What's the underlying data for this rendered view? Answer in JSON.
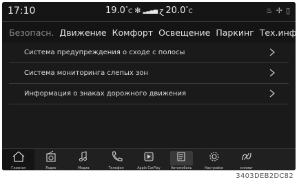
{
  "status": {
    "time": "17:10",
    "left_temp": "19.0",
    "right_temp": "20.0",
    "deg_unit": "C",
    "right_icons": [
      "seat-heat-icon",
      "seat-cool-icon",
      "phone-battery-icon"
    ]
  },
  "tabs": [
    {
      "label": "Безопасн."
    },
    {
      "label": "Движение"
    },
    {
      "label": "Комфорт"
    },
    {
      "label": "Освещение"
    },
    {
      "label": "Паркинг"
    },
    {
      "label": "Тех.инфо"
    }
  ],
  "settings": [
    {
      "label": "Система предупреждения о сходе с полосы"
    },
    {
      "label": "Система мониторинга слепых зон"
    },
    {
      "label": "Информация о знаках дорожного движения"
    }
  ],
  "dock": [
    {
      "label": "Главная",
      "icon": "home-icon"
    },
    {
      "label": "Радио",
      "icon": "radio-icon"
    },
    {
      "label": "Медиа",
      "icon": "music-note-icon"
    },
    {
      "label": "Телефон",
      "icon": "phone-icon"
    },
    {
      "label": "Apple CarPlay",
      "icon": "carplay-icon"
    },
    {
      "label": "Автомобиль",
      "icon": "vehicle-icon"
    },
    {
      "label": "Настройки",
      "icon": "gear-icon"
    },
    {
      "label": "климат",
      "icon": "climate-icon"
    }
  ],
  "caption": "3403DEB2DC82",
  "colors": {
    "background": "#1a1a1b",
    "text": "#e4e4e4",
    "active_tab": "#8a8a8a",
    "divider": "#3b3b3b"
  }
}
